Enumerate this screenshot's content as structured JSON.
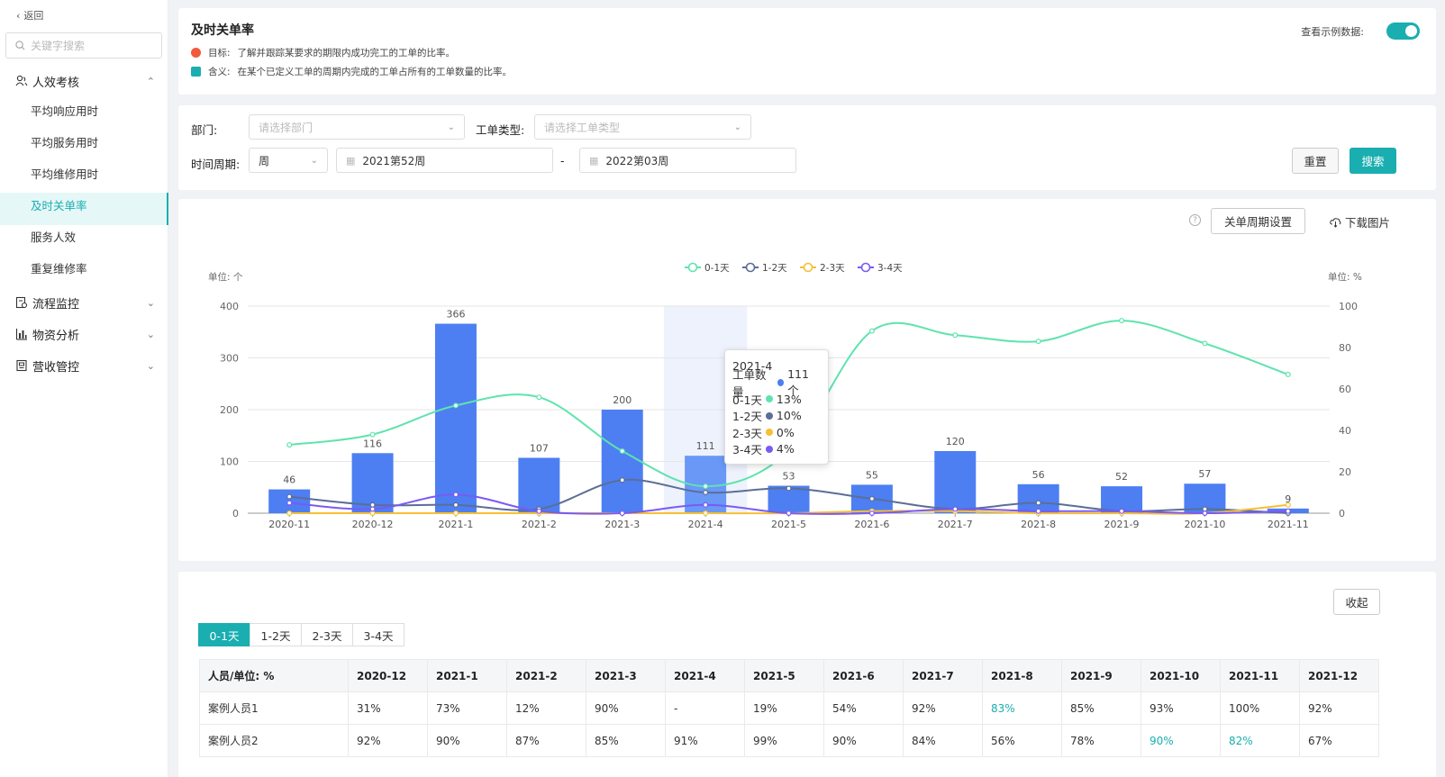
{
  "sidebar": {
    "back_label": "返回",
    "search_placeholder": "关键字搜索",
    "groups": [
      {
        "label": "人效考核",
        "icon": "people-icon",
        "expanded": true,
        "items": [
          "平均响应用时",
          "平均服务用时",
          "平均维修用时",
          "及时关单率",
          "服务人效",
          "重复维修率"
        ]
      },
      {
        "label": "流程监控",
        "icon": "flow-icon",
        "expanded": false
      },
      {
        "label": "物资分析",
        "icon": "bar-chart-icon",
        "expanded": false
      },
      {
        "label": "营收管控",
        "icon": "ledger-icon",
        "expanded": false
      }
    ],
    "active_item": "及时关单率"
  },
  "header": {
    "title": "及时关单率",
    "goal_label": "目标:",
    "goal_text": "了解并跟踪某要求的期限内成功完工的工单的比率。",
    "meaning_label": "含义:",
    "meaning_text": "在某个已定义工单的周期内完成的工单占所有的工单数量的比率。",
    "toggle_label": "查看示例数据:",
    "toggle_on": true
  },
  "filters": {
    "dept_label": "部门:",
    "dept_placeholder": "请选择部门",
    "type_label": "工单类型:",
    "type_placeholder": "请选择工单类型",
    "period_label": "时间周期:",
    "period_value": "周",
    "start_value": "2021第52周",
    "separator": "-",
    "end_value": "2022第03周",
    "reset_label": "重置",
    "search_label": "搜索"
  },
  "chart_toolbar": {
    "help": "?",
    "cycle_settings_label": "关单周期设置",
    "download_label": "下载图片"
  },
  "chart_data": {
    "type": "bar",
    "categories": [
      "2020-11",
      "2020-12",
      "2021-1",
      "2021-2",
      "2021-3",
      "2021-4",
      "2021-5",
      "2021-6",
      "2021-7",
      "2021-8",
      "2021-9",
      "2021-10",
      "2021-11"
    ],
    "left_unit_label": "单位: 个",
    "right_unit_label": "单位: %",
    "ylim_left": [
      0,
      400
    ],
    "yticks_left": [
      0,
      100,
      200,
      300,
      400
    ],
    "ylim_right": [
      0,
      100
    ],
    "yticks_right": [
      0,
      20,
      40,
      60,
      80,
      100
    ],
    "bar_series": {
      "name": "工单数量",
      "color": "#4d7ff2",
      "unit": "个",
      "values": [
        46,
        116,
        366,
        107,
        200,
        111,
        53,
        55,
        120,
        56,
        52,
        57,
        9
      ]
    },
    "highlight_index": 5,
    "line_series": [
      {
        "name": "0-1天",
        "color": "#5fe3ae",
        "values": [
          33,
          38,
          52,
          56,
          30,
          13,
          30,
          88,
          86,
          83,
          93,
          82,
          67
        ]
      },
      {
        "name": "1-2天",
        "color": "#5b6e96",
        "values": [
          8,
          4,
          4,
          2,
          16,
          10,
          12,
          7,
          2,
          5,
          1,
          2,
          0
        ]
      },
      {
        "name": "2-3天",
        "color": "#f7bf32",
        "values": [
          0,
          0,
          0,
          0,
          0,
          0,
          0,
          1,
          1,
          0,
          0,
          0,
          4
        ]
      },
      {
        "name": "3-4天",
        "color": "#7a5af3",
        "values": [
          5,
          2,
          9,
          1,
          0,
          4,
          0,
          0,
          2,
          1,
          1,
          0,
          1
        ]
      }
    ],
    "grid": true,
    "legend": "top-center"
  },
  "tooltip": {
    "title": "2021-4",
    "rows": [
      {
        "label": "工单数量",
        "color": "#4d7ff2",
        "value": "111 个"
      },
      {
        "label": "0-1天",
        "color": "#5fe3ae",
        "value": "13%"
      },
      {
        "label": "1-2天",
        "color": "#5b6e96",
        "value": "10%"
      },
      {
        "label": "2-3天",
        "color": "#f7bf32",
        "value": "0%"
      },
      {
        "label": "3-4天",
        "color": "#7a5af3",
        "value": "4%"
      }
    ]
  },
  "table_section": {
    "collapse_label": "收起",
    "tabs": [
      "0-1天",
      "1-2天",
      "2-3天",
      "3-4天"
    ],
    "active_tab": 0,
    "headers": [
      "人员/单位: %",
      "2020-12",
      "2021-1",
      "2021-2",
      "2021-3",
      "2021-4",
      "2021-5",
      "2021-6",
      "2021-7",
      "2021-8",
      "2021-9",
      "2021-10",
      "2021-11",
      "2021-12"
    ],
    "rows": [
      {
        "cells": [
          "案例人员1",
          "31%",
          "73%",
          "12%",
          "90%",
          "-",
          "19%",
          "54%",
          "92%",
          "83%",
          "85%",
          "93%",
          "100%",
          "92%"
        ],
        "highlight": [
          9
        ]
      },
      {
        "cells": [
          "案例人员2",
          "92%",
          "90%",
          "87%",
          "85%",
          "91%",
          "99%",
          "90%",
          "84%",
          "56%",
          "78%",
          "90%",
          "82%",
          "67%"
        ],
        "highlight": [
          11,
          12
        ]
      }
    ],
    "highlight_color": "#1aaeb0"
  }
}
